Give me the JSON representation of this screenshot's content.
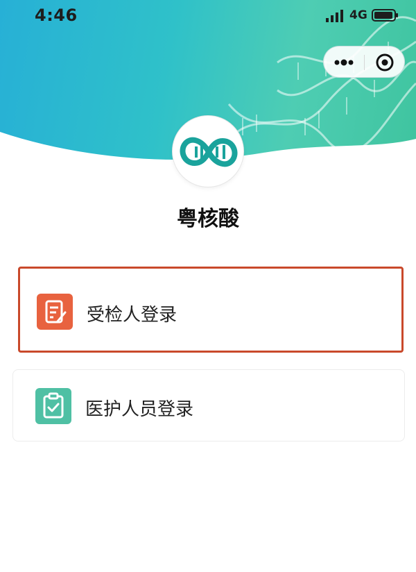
{
  "status_bar": {
    "time": "4:46",
    "network": "4G",
    "icons": [
      "signal-icon",
      "battery-icon"
    ]
  },
  "capsule": {
    "icons": [
      "more-dots-icon",
      "close-circle-icon"
    ]
  },
  "app": {
    "title": "粤核酸",
    "logo_icon": "dna-logo-icon"
  },
  "login_options": [
    {
      "label": "受检人登录",
      "icon": "edit-document-icon",
      "icon_color": "#e8623f",
      "selected": true
    },
    {
      "label": "医护人员登录",
      "icon": "clipboard-check-icon",
      "icon_color": "#4fc0a4",
      "selected": false
    }
  ],
  "colors": {
    "banner_start": "#27b0d6",
    "banner_end": "#3fc49f",
    "highlight_border": "#c9492b",
    "logo_teal": "#1aa39c"
  }
}
